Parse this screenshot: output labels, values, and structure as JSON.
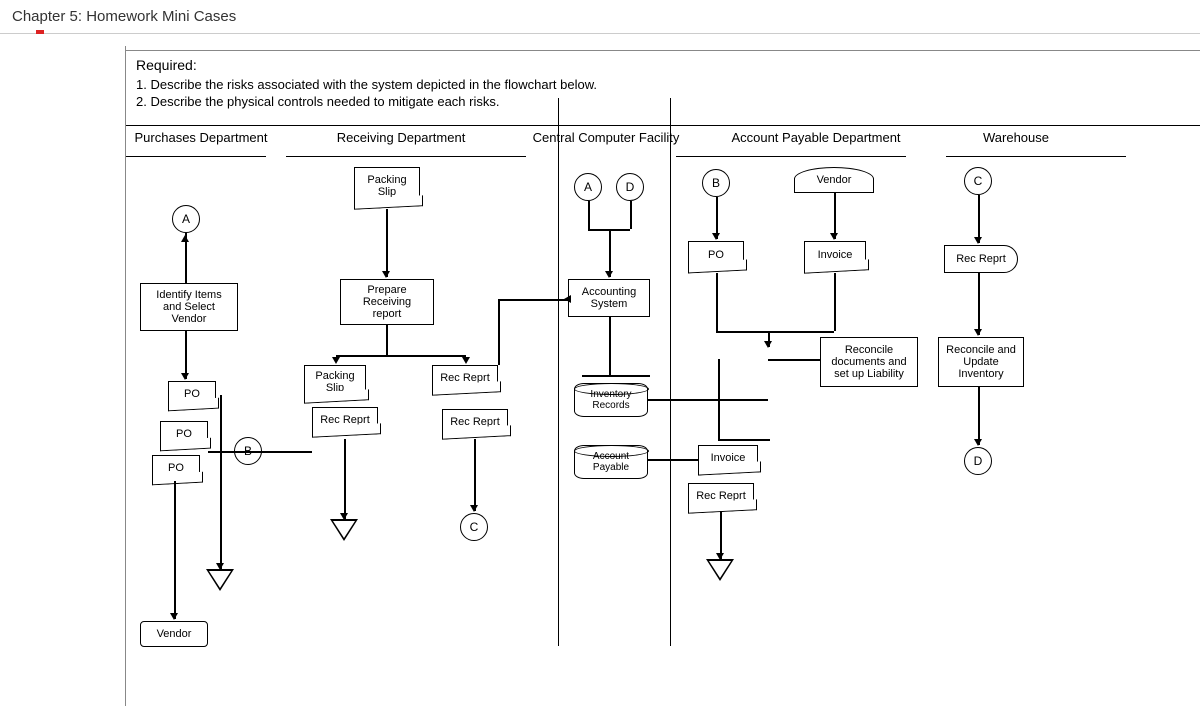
{
  "header": {
    "title": "Chapter 5: Homework Mini Cases"
  },
  "required": {
    "title": "Required:",
    "items": [
      "Describe the risks associated with the system depicted in the flowchart below.",
      "Describe the physical controls needed to mitigate each risks."
    ]
  },
  "columns": {
    "purchases": "Purchases Department",
    "receiving": "Receiving Department",
    "central": "Central Computer Facility",
    "ap": "Account Payable Department",
    "warehouse": "Warehouse"
  },
  "shapes": {
    "conn_a1": "A",
    "identify": "Identify Items\nand Select\nVendor",
    "po1": "PO",
    "po2": "PO",
    "po3": "PO",
    "conn_b1": "B",
    "vendor": "Vendor",
    "packing_slip": "Packing\nSlip",
    "prepare": "Prepare\nReceiving\nreport",
    "packing_slip2": "Packing\nSlip",
    "rec_reprt1": "Rec Reprt",
    "rec_reprt2": "Rec Reprt",
    "rec_reprt3": "Rec Reprt",
    "conn_c1": "C",
    "conn_a2": "A",
    "conn_d1": "D",
    "accounting": "Accounting\nSystem",
    "inventory": "Inventory\nRecords",
    "account_payable": "Account\nPayable",
    "conn_b2": "B",
    "vendor2": "Vendor",
    "po4": "PO",
    "invoice_doc": "Invoice",
    "reconcile": "Reconcile\ndocuments and\nset up Liability",
    "invoice_doc2": "Invoice",
    "rec_reprt4": "Rec Reprt",
    "conn_c2": "C",
    "rec_reprt5": "Rec Reprt",
    "reconcile2": "Reconcile and\nUpdate\nInventory",
    "conn_d2": "D"
  }
}
